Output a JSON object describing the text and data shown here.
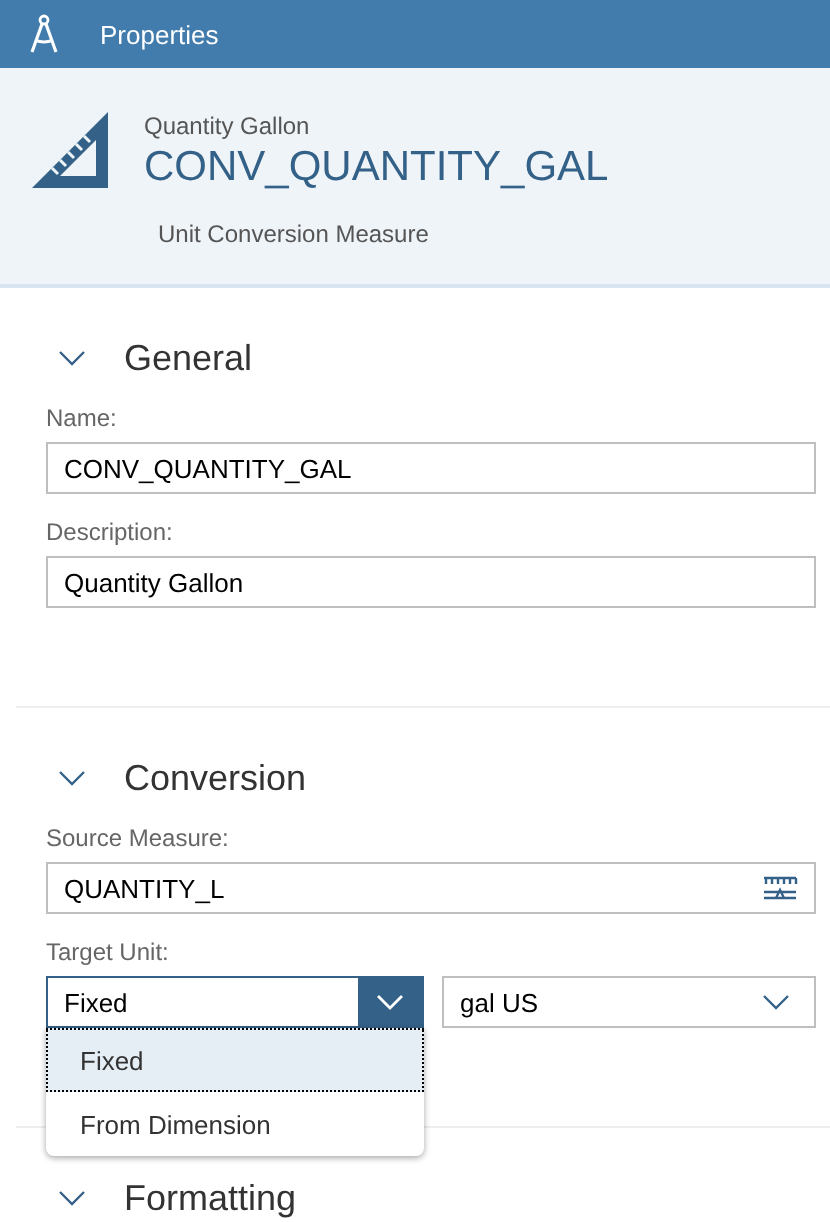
{
  "title_bar": {
    "title": "Properties"
  },
  "header": {
    "subtitle": "Quantity Gallon",
    "title": "CONV_QUANTITY_GAL",
    "type": "Unit Conversion Measure"
  },
  "sections": [
    {
      "title": "General",
      "expanded": true,
      "fields": [
        {
          "kind": "text",
          "label": "Name:",
          "value": "CONV_QUANTITY_GAL"
        },
        {
          "kind": "text",
          "label": "Description:",
          "value": "Quantity Gallon"
        }
      ]
    },
    {
      "title": "Conversion",
      "expanded": true,
      "fields": [
        {
          "kind": "value_help",
          "label": "Source Measure:",
          "value": "QUANTITY_L"
        },
        {
          "kind": "select_pair",
          "label": "Target Unit:",
          "value": "Fixed",
          "open": true,
          "options": [
            {
              "label": "Fixed",
              "selected": true
            },
            {
              "label": "From Dimension",
              "selected": false
            }
          ],
          "value2": "gal US"
        }
      ]
    },
    {
      "title": "Formatting",
      "expanded": true
    }
  ]
}
